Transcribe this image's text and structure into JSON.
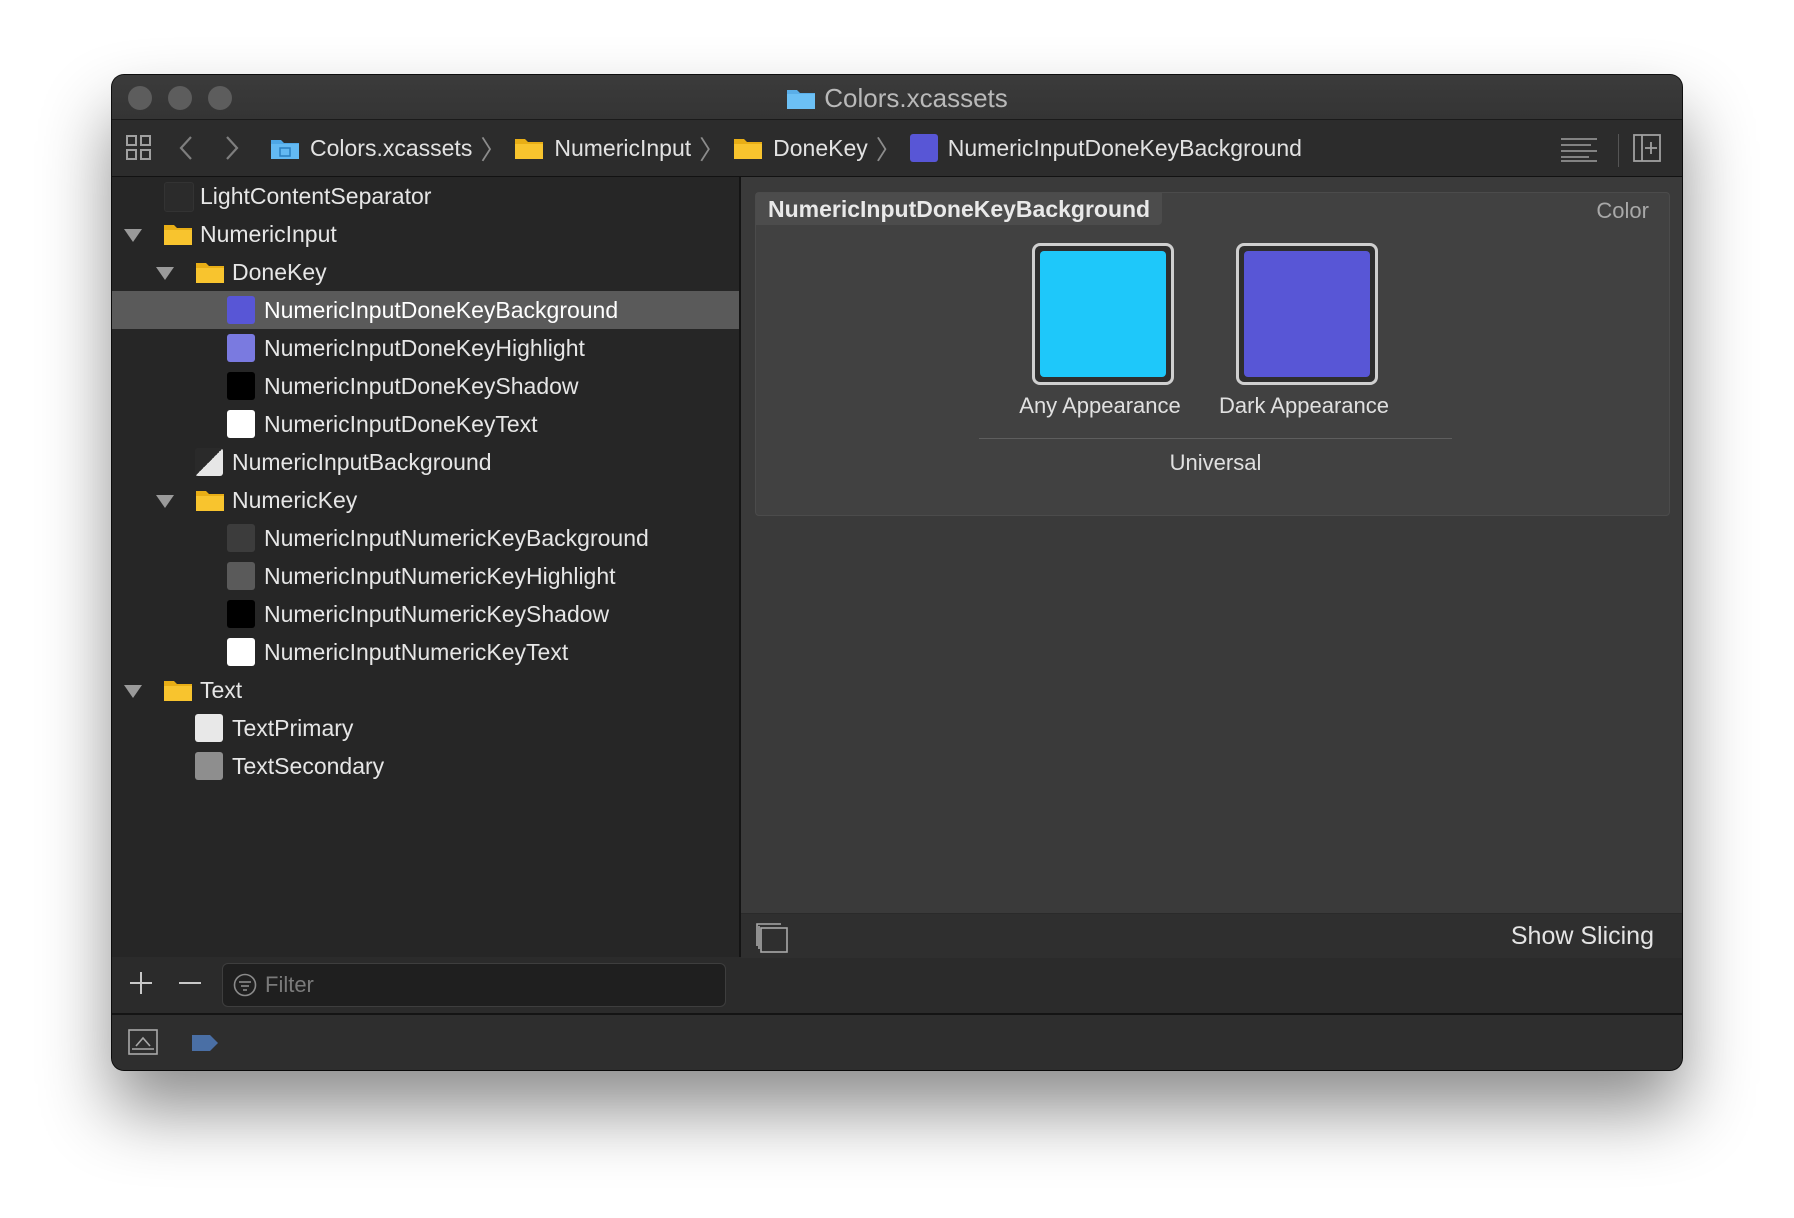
{
  "window": {
    "title": "Colors.xcassets"
  },
  "breadcrumb": [
    {
      "label": "Colors.xcassets",
      "icon": "asset-catalog-folder-icon"
    },
    {
      "label": "NumericInput",
      "icon": "folder-icon"
    },
    {
      "label": "DoneKey",
      "icon": "folder-icon"
    },
    {
      "label": "NumericInputDoneKeyBackground",
      "icon": "color-swatch-icon",
      "color": "#5856d6"
    }
  ],
  "sidebar": {
    "items": [
      {
        "label": "LightContentSeparator",
        "type": "color",
        "color": "#2b2b2b"
      },
      {
        "label": "NumericInput",
        "type": "folder",
        "expanded": true
      },
      {
        "label": "DoneKey",
        "type": "folder",
        "expanded": true
      },
      {
        "label": "NumericInputDoneKeyBackground",
        "type": "color",
        "color": "#5856d6",
        "selected": true
      },
      {
        "label": "NumericInputDoneKeyHighlight",
        "type": "color",
        "color": "#7a7ae0"
      },
      {
        "label": "NumericInputDoneKeyShadow",
        "type": "color",
        "color": "#000000"
      },
      {
        "label": "NumericInputDoneKeyText",
        "type": "color",
        "color": "#ffffff"
      },
      {
        "label": "NumericInputBackground",
        "type": "color",
        "color": "split-light-dark"
      },
      {
        "label": "NumericKey",
        "type": "folder",
        "expanded": true
      },
      {
        "label": "NumericInputNumericKeyBackground",
        "type": "color",
        "color": "#3c3c3c"
      },
      {
        "label": "NumericInputNumericKeyHighlight",
        "type": "color",
        "color": "#5a5a5a"
      },
      {
        "label": "NumericInputNumericKeyShadow",
        "type": "color",
        "color": "#000000"
      },
      {
        "label": "NumericInputNumericKeyText",
        "type": "color",
        "color": "#ffffff"
      },
      {
        "label": "Text",
        "type": "folder",
        "expanded": true
      },
      {
        "label": "TextPrimary",
        "type": "color",
        "color": "#e8e8e8"
      },
      {
        "label": "TextSecondary",
        "type": "color",
        "color": "#8e8e8e"
      }
    ],
    "filter_placeholder": "Filter"
  },
  "editor": {
    "asset_name": "NumericInputDoneKeyBackground",
    "asset_kind": "Color",
    "wells": [
      {
        "label": "Any Appearance",
        "color": "#1ec8fa"
      },
      {
        "label": "Dark Appearance",
        "color": "#5856d6"
      }
    ],
    "scope_label": "Universal",
    "show_slicing_label": "Show Slicing"
  },
  "colors": {
    "accent_folder": "#f8c42e",
    "selection": "#5a5a5a",
    "status_tag": "#4a6fa5"
  }
}
